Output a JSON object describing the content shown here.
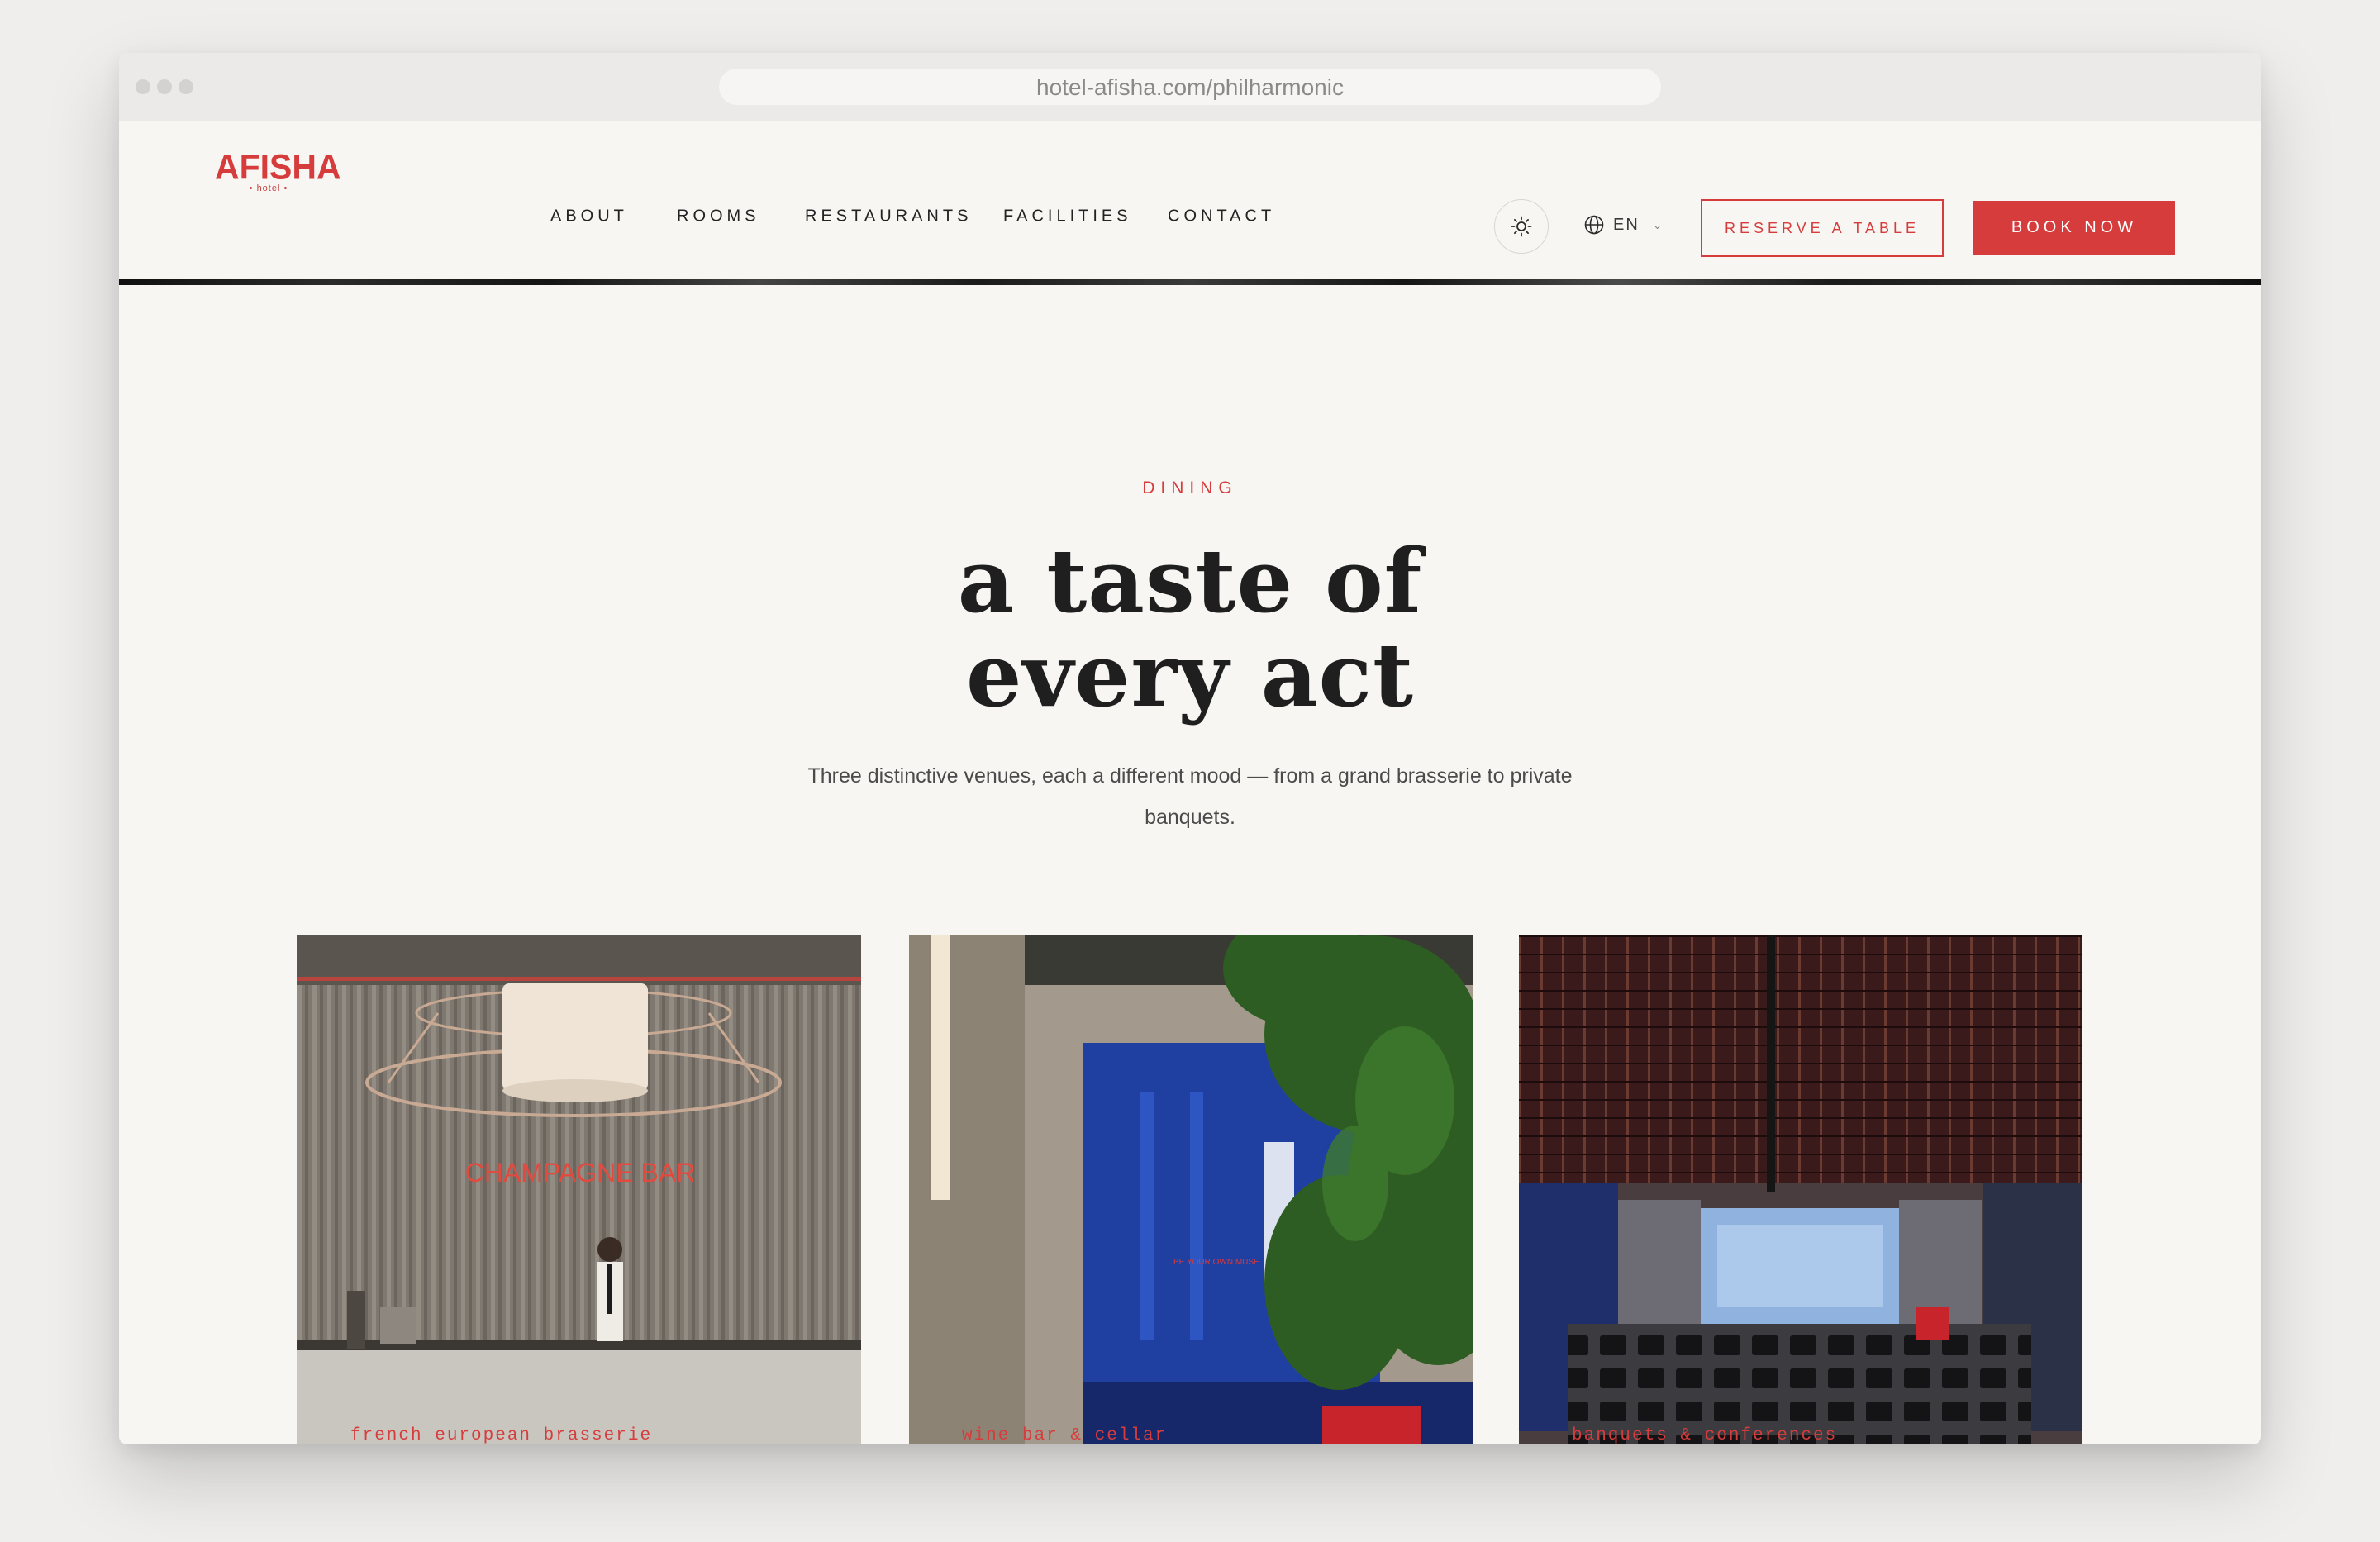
{
  "browser": {
    "url": "hotel-afisha.com/philharmonic"
  },
  "brand": {
    "name": "AFISHA",
    "tagline": "• hotel •",
    "accent_color": "#d63c3c"
  },
  "nav": {
    "items": [
      {
        "label": "ABOUT"
      },
      {
        "label": "ROOMS"
      },
      {
        "label": "RESTAURANTS"
      },
      {
        "label": "FACILITIES"
      },
      {
        "label": "CONTACT"
      }
    ],
    "theme_icon": "sun-icon",
    "language": "EN",
    "reserve_label": "RESERVE A TABLE",
    "book_label": "BOOK NOW"
  },
  "section": {
    "eyebrow": "DINING",
    "title_line1": "a taste of",
    "title_line2": "every act",
    "description": "Three distinctive venues, each a different mood — from a grand brasserie to private banquets."
  },
  "venues": [
    {
      "label": "french european brasserie",
      "sign": "CHAMPAGNE BAR"
    },
    {
      "label": "wine bar & cellar",
      "sign": "BE YOUR OWN MUSE"
    },
    {
      "label": "banquets & conferences"
    }
  ]
}
